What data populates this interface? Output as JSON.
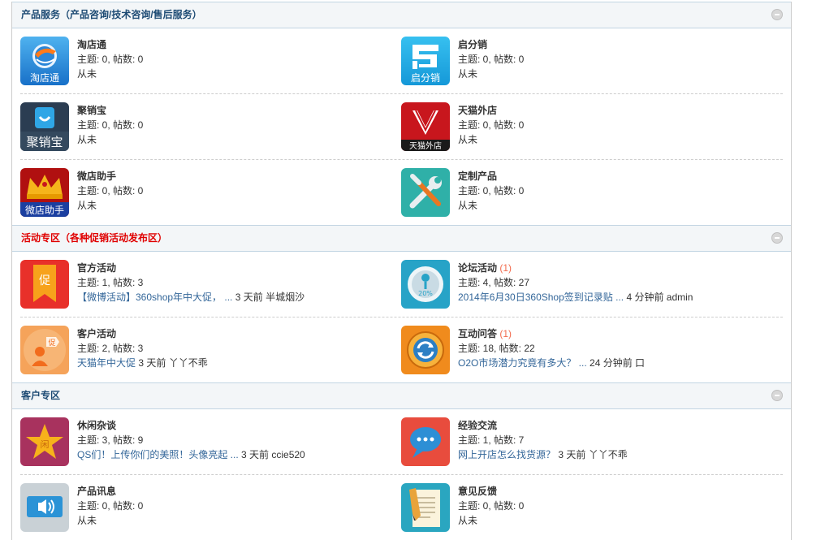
{
  "categories": [
    {
      "title": "产品服务（产品咨询/技术咨询/售后服务）",
      "title_color": "#1c4a73",
      "rows": [
        [
          {
            "name": "淘店通",
            "stats": "主题: 0, 帖数: 0",
            "last": "从未",
            "icon": "taodiantong-icon",
            "icon_text": "淘店通"
          },
          {
            "name": "启分销",
            "stats": "主题: 0, 帖数: 0",
            "last": "从未",
            "icon": "qifenxiao-icon",
            "icon_text": "启分销"
          }
        ],
        [
          {
            "name": "聚销宝",
            "stats": "主题: 0, 帖数: 0",
            "last": "从未",
            "icon": "juxiaobao-icon",
            "icon_text": "聚销宝"
          },
          {
            "name": "天猫外店",
            "stats": "主题: 0, 帖数: 0",
            "last": "从未",
            "icon": "tmall-waidian-icon",
            "icon_text": "天猫外店"
          }
        ],
        [
          {
            "name": "微店助手",
            "stats": "主题: 0, 帖数: 0",
            "last": "从未",
            "icon": "weidian-crown-icon",
            "icon_text": "微店助手"
          },
          {
            "name": "定制产品",
            "stats": "主题: 0, 帖数: 0",
            "last": "从未",
            "icon": "tools-icon"
          }
        ]
      ]
    },
    {
      "title": "活动专区（各种促销活动发布区）",
      "title_color": "#e00000",
      "rows": [
        [
          {
            "name": "官方活动",
            "stats": "主题: 1, 帖数: 3",
            "last_link": "【微博活动】360shop年中大促， ...",
            "last_meta": " 3 天前 半城烟沙",
            "icon": "promo-ribbon-icon",
            "icon_text": "促"
          },
          {
            "name": "论坛活动",
            "new": " (1)",
            "stats": "主题: 4, 帖数: 27",
            "last_link": "2014年6月30日360Shop签到记录贴 ...",
            "last_meta": " 4 分钟前 admin",
            "icon": "discount-badge-icon",
            "icon_text": "20%"
          }
        ],
        [
          {
            "name": "客户活动",
            "stats": "主题: 2, 帖数: 3",
            "last_link": "天猫年中大促",
            "last_meta": " 3 天前 丫丫不乖",
            "icon": "customer-tag-icon",
            "icon_text": "促"
          },
          {
            "name": "互动问答",
            "new": " (1)",
            "stats": "主题: 18, 帖数: 22",
            "last_link": "O2O市场潜力究竟有多大？ ...",
            "last_meta": " 24 分钟前 口",
            "icon": "refresh-cycle-icon"
          }
        ]
      ]
    },
    {
      "title": "客户专区",
      "title_color": "#1c4a73",
      "rows": [
        [
          {
            "name": "休闲杂谈",
            "stats": "主题: 3, 帖数: 9",
            "last_link": "QS们！上传你们的美照！头像亮起 ...",
            "last_meta": " 3 天前 ccie520",
            "icon": "star-icon",
            "icon_text": "闲"
          },
          {
            "name": "经验交流",
            "stats": "主题: 1, 帖数: 7",
            "last_link": "网上开店怎么找货源？",
            "last_meta": " 3 天前 丫丫不乖",
            "icon": "chat-bubble-icon"
          }
        ],
        [
          {
            "name": "产品讯息",
            "stats": "主题: 0, 帖数: 0",
            "last": "从未",
            "icon": "speaker-icon"
          },
          {
            "name": "意见反馈",
            "stats": "主题: 0, 帖数: 0",
            "last": "从未",
            "icon": "notepad-pencil-icon"
          }
        ]
      ]
    }
  ],
  "colors": {
    "link": "#336699",
    "new_count": "#f26c4f",
    "header_bg": "#f3f6f8",
    "border": "#c2d5e3"
  }
}
